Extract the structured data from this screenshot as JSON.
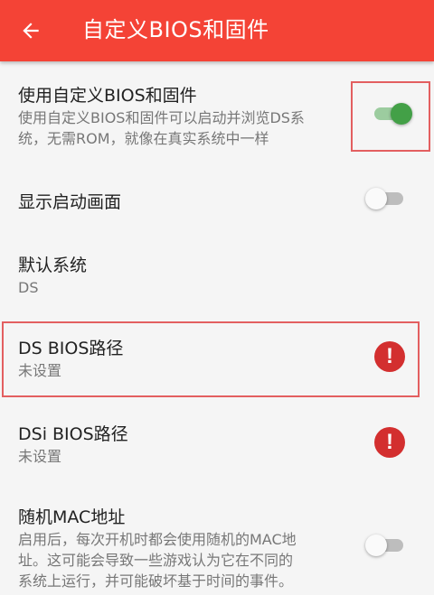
{
  "appbar": {
    "back_icon": "arrow-left-icon",
    "title": "自定义BIOS和固件",
    "color": "#f44336"
  },
  "settings": [
    {
      "title": "使用自定义BIOS和固件",
      "subtitle_lines": [
        "使用自定义BIOS和固件可以启动并浏览DS系",
        "统，无需ROM，就像在真实系统中一样"
      ],
      "switch": "on"
    },
    {
      "title": "显示启动画面",
      "switch": "off"
    },
    {
      "title": "默认系统",
      "subtitle": "DS"
    },
    {
      "title": "DS BIOS路径",
      "subtitle": "未设置",
      "status_icon": "error-icon",
      "status_glyph": "!"
    },
    {
      "title": "DSi BIOS路径",
      "subtitle": "未设置",
      "status_icon": "error-icon",
      "status_glyph": "!"
    },
    {
      "title": "随机MAC地址",
      "subtitle_lines": [
        "启用后，每次开机时都会使用随机的MAC地",
        "址。这可能会导致一些游戏认为它在不同的",
        "系统上运行，并可能破坏基于时间的事件。"
      ],
      "switch": "off"
    }
  ],
  "colors": {
    "accent_red": "#f44336",
    "switch_on": "#43a047",
    "error": "#d32f2f",
    "highlight_border": "#e35f60"
  }
}
